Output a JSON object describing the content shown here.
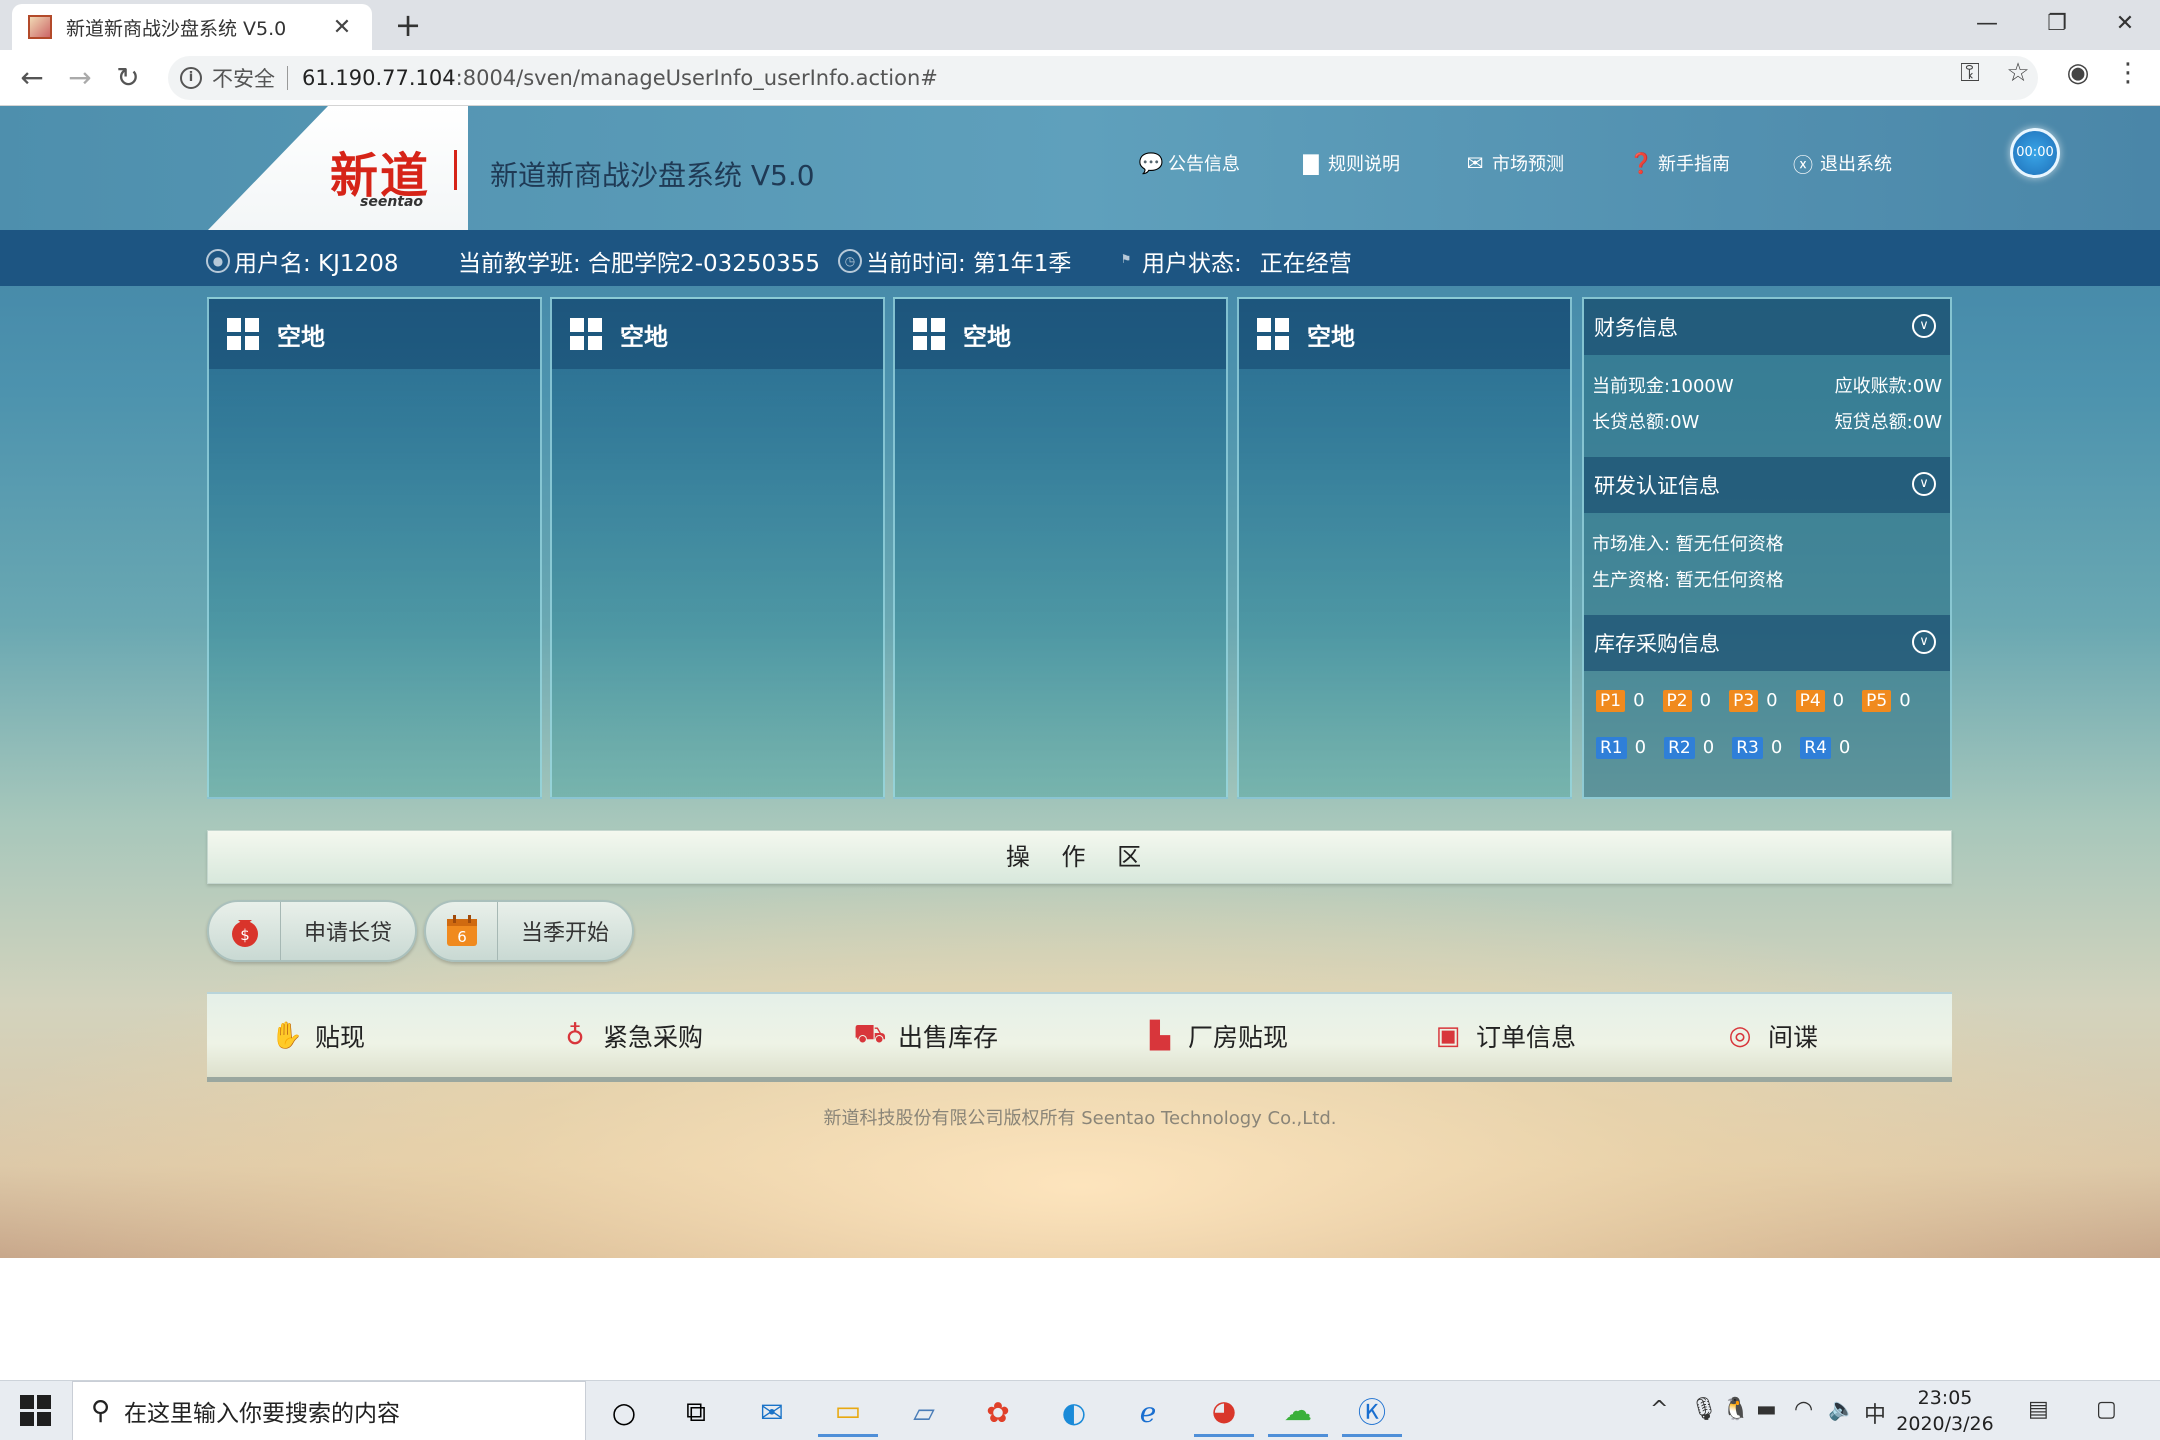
{
  "browser": {
    "tab_title": "新道新商战沙盘系统 V5.0",
    "tab_close": "✕",
    "new_tab": "+",
    "security_label": "不安全",
    "url_host": "61.190.77.104",
    "url_rest": ":8004/sven/manageUserInfo_userInfo.action#"
  },
  "header": {
    "logo_text": "新道",
    "logo_sub": "seentao",
    "system_title": "新道新商战沙盘系统 V5.0",
    "nav": [
      {
        "label": "公告信息",
        "icon": "speech-bubble-icon"
      },
      {
        "label": "规则说明",
        "icon": "document-icon"
      },
      {
        "label": "市场预测",
        "icon": "envelope-icon"
      },
      {
        "label": "新手指南",
        "icon": "question-icon"
      },
      {
        "label": "退出系统",
        "icon": "close-circle-icon"
      }
    ],
    "timer": "00:00"
  },
  "status": {
    "username": "用户名: KJ1208",
    "class": "当前教学班: 合肥学院2-03250355",
    "time": "当前时间: 第1年1季",
    "state_label": "用户状态:",
    "state_value": "正在经营"
  },
  "lands": [
    {
      "label": "空地"
    },
    {
      "label": "空地"
    },
    {
      "label": "空地"
    },
    {
      "label": "空地"
    }
  ],
  "finance": {
    "title": "财务信息",
    "cash": "当前现金:1000W",
    "receivable": "应收账款:0W",
    "long_loan": "长贷总额:0W",
    "short_loan": "短贷总额:0W"
  },
  "rd": {
    "title": "研发认证信息",
    "market": "市场准入: 暂无任何资格",
    "production": "生产资格: 暂无任何资格"
  },
  "inventory": {
    "title": "库存采购信息",
    "products": [
      {
        "name": "P1",
        "qty": "0"
      },
      {
        "name": "P2",
        "qty": "0"
      },
      {
        "name": "P3",
        "qty": "0"
      },
      {
        "name": "P4",
        "qty": "0"
      },
      {
        "name": "P5",
        "qty": "0"
      }
    ],
    "materials": [
      {
        "name": "R1",
        "qty": "0"
      },
      {
        "name": "R2",
        "qty": "0"
      },
      {
        "name": "R3",
        "qty": "0"
      },
      {
        "name": "R4",
        "qty": "0"
      }
    ],
    "product_color": "#f08a1e",
    "material_color": "#2f7fd8"
  },
  "operation": {
    "title": "操 作 区",
    "buttons": [
      {
        "label": "申请长贷",
        "icon": "money-bag-icon"
      },
      {
        "label": "当季开始",
        "icon": "calendar-icon",
        "icon_text": "6"
      }
    ],
    "actions": [
      {
        "label": "贴现",
        "icon": "hand-coin-icon"
      },
      {
        "label": "紧急采购",
        "icon": "lightbulb-icon"
      },
      {
        "label": "出售库存",
        "icon": "truck-icon"
      },
      {
        "label": "厂房贴现",
        "icon": "factory-icon"
      },
      {
        "label": "订单信息",
        "icon": "order-icon"
      },
      {
        "label": "间谍",
        "icon": "compass-icon"
      }
    ]
  },
  "footer": {
    "copyright": "新道科技股份有限公司版权所有 Seentao Technology Co.,Ltd."
  },
  "taskbar": {
    "search_placeholder": "在这里输入你要搜索的内容",
    "ime": "中",
    "time": "23:05",
    "date": "2020/3/26"
  }
}
